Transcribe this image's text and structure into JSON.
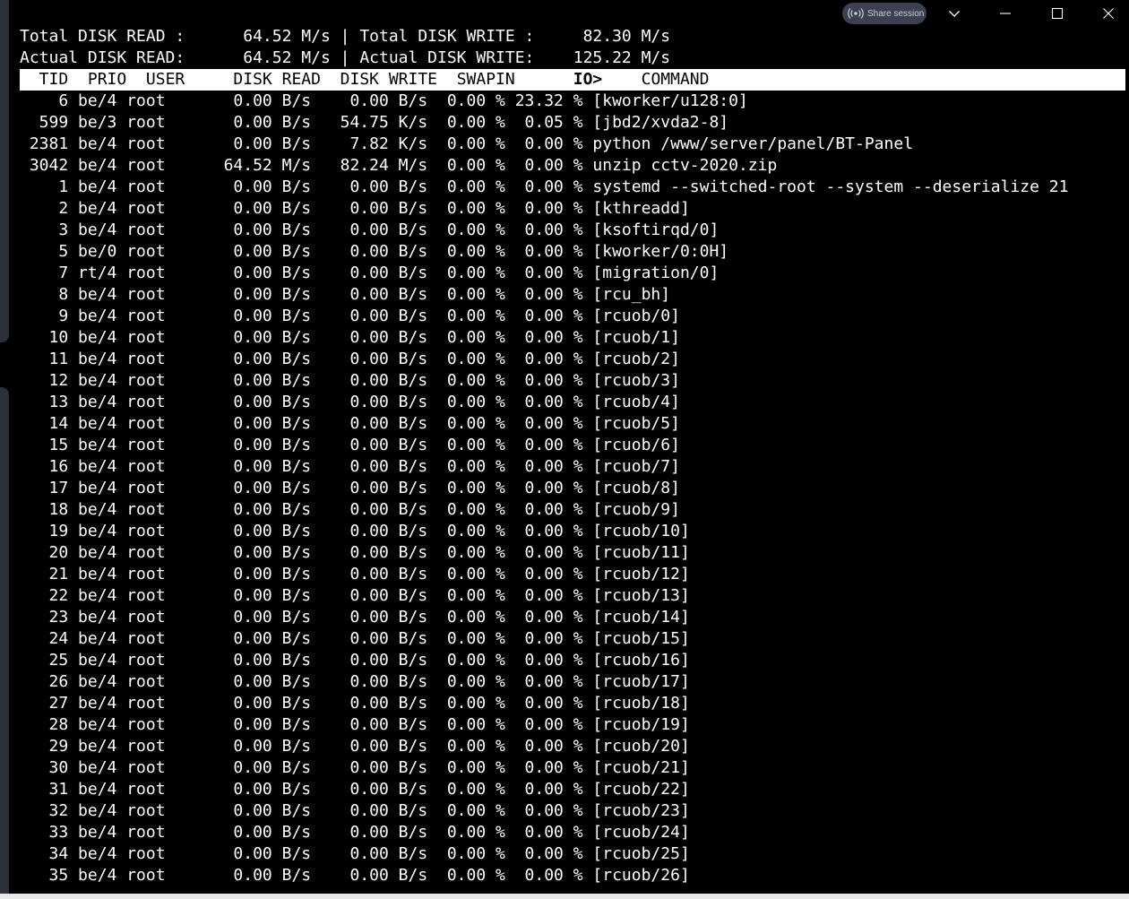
{
  "window": {
    "share_session_label": "Share session",
    "icons": {
      "share": "broadcast-icon",
      "chevron": "chevron-down-icon",
      "minimize": "minimize-icon",
      "maximize": "maximize-icon",
      "close": "close-icon"
    }
  },
  "summary": {
    "total_read_label": "Total DISK READ :",
    "total_read_value": "64.52 M/s",
    "total_write_label": "Total DISK WRITE :",
    "total_write_value": "82.30 M/s",
    "actual_read_label": "Actual DISK READ:",
    "actual_read_value": "64.52 M/s",
    "actual_write_label": "Actual DISK WRITE:",
    "actual_write_value": "125.22 M/s"
  },
  "columns": {
    "tid": "TID",
    "prio": "PRIO",
    "user": "USER",
    "disk_read": "DISK READ",
    "disk_write": "DISK WRITE",
    "swapin": "SWAPIN",
    "io": "IO>",
    "command": "COMMAND"
  },
  "processes": [
    {
      "tid": "6",
      "prio": "be/4",
      "user": "root",
      "read": "0.00 B/s",
      "write": "0.00 B/s",
      "swapin": "0.00 %",
      "io": "23.32 %",
      "command": "[kworker/u128:0]"
    },
    {
      "tid": "599",
      "prio": "be/3",
      "user": "root",
      "read": "0.00 B/s",
      "write": "54.75 K/s",
      "swapin": "0.00 %",
      "io": "0.05 %",
      "command": "[jbd2/xvda2-8]"
    },
    {
      "tid": "2381",
      "prio": "be/4",
      "user": "root",
      "read": "0.00 B/s",
      "write": "7.82 K/s",
      "swapin": "0.00 %",
      "io": "0.00 %",
      "command": "python /www/server/panel/BT-Panel"
    },
    {
      "tid": "3042",
      "prio": "be/4",
      "user": "root",
      "read": "64.52 M/s",
      "write": "82.24 M/s",
      "swapin": "0.00 %",
      "io": "0.00 %",
      "command": "unzip cctv-2020.zip"
    },
    {
      "tid": "1",
      "prio": "be/4",
      "user": "root",
      "read": "0.00 B/s",
      "write": "0.00 B/s",
      "swapin": "0.00 %",
      "io": "0.00 %",
      "command": "systemd --switched-root --system --deserialize 21"
    },
    {
      "tid": "2",
      "prio": "be/4",
      "user": "root",
      "read": "0.00 B/s",
      "write": "0.00 B/s",
      "swapin": "0.00 %",
      "io": "0.00 %",
      "command": "[kthreadd]"
    },
    {
      "tid": "3",
      "prio": "be/4",
      "user": "root",
      "read": "0.00 B/s",
      "write": "0.00 B/s",
      "swapin": "0.00 %",
      "io": "0.00 %",
      "command": "[ksoftirqd/0]"
    },
    {
      "tid": "5",
      "prio": "be/0",
      "user": "root",
      "read": "0.00 B/s",
      "write": "0.00 B/s",
      "swapin": "0.00 %",
      "io": "0.00 %",
      "command": "[kworker/0:0H]"
    },
    {
      "tid": "7",
      "prio": "rt/4",
      "user": "root",
      "read": "0.00 B/s",
      "write": "0.00 B/s",
      "swapin": "0.00 %",
      "io": "0.00 %",
      "command": "[migration/0]"
    },
    {
      "tid": "8",
      "prio": "be/4",
      "user": "root",
      "read": "0.00 B/s",
      "write": "0.00 B/s",
      "swapin": "0.00 %",
      "io": "0.00 %",
      "command": "[rcu_bh]"
    },
    {
      "tid": "9",
      "prio": "be/4",
      "user": "root",
      "read": "0.00 B/s",
      "write": "0.00 B/s",
      "swapin": "0.00 %",
      "io": "0.00 %",
      "command": "[rcuob/0]"
    },
    {
      "tid": "10",
      "prio": "be/4",
      "user": "root",
      "read": "0.00 B/s",
      "write": "0.00 B/s",
      "swapin": "0.00 %",
      "io": "0.00 %",
      "command": "[rcuob/1]"
    },
    {
      "tid": "11",
      "prio": "be/4",
      "user": "root",
      "read": "0.00 B/s",
      "write": "0.00 B/s",
      "swapin": "0.00 %",
      "io": "0.00 %",
      "command": "[rcuob/2]"
    },
    {
      "tid": "12",
      "prio": "be/4",
      "user": "root",
      "read": "0.00 B/s",
      "write": "0.00 B/s",
      "swapin": "0.00 %",
      "io": "0.00 %",
      "command": "[rcuob/3]"
    },
    {
      "tid": "13",
      "prio": "be/4",
      "user": "root",
      "read": "0.00 B/s",
      "write": "0.00 B/s",
      "swapin": "0.00 %",
      "io": "0.00 %",
      "command": "[rcuob/4]"
    },
    {
      "tid": "14",
      "prio": "be/4",
      "user": "root",
      "read": "0.00 B/s",
      "write": "0.00 B/s",
      "swapin": "0.00 %",
      "io": "0.00 %",
      "command": "[rcuob/5]"
    },
    {
      "tid": "15",
      "prio": "be/4",
      "user": "root",
      "read": "0.00 B/s",
      "write": "0.00 B/s",
      "swapin": "0.00 %",
      "io": "0.00 %",
      "command": "[rcuob/6]"
    },
    {
      "tid": "16",
      "prio": "be/4",
      "user": "root",
      "read": "0.00 B/s",
      "write": "0.00 B/s",
      "swapin": "0.00 %",
      "io": "0.00 %",
      "command": "[rcuob/7]"
    },
    {
      "tid": "17",
      "prio": "be/4",
      "user": "root",
      "read": "0.00 B/s",
      "write": "0.00 B/s",
      "swapin": "0.00 %",
      "io": "0.00 %",
      "command": "[rcuob/8]"
    },
    {
      "tid": "18",
      "prio": "be/4",
      "user": "root",
      "read": "0.00 B/s",
      "write": "0.00 B/s",
      "swapin": "0.00 %",
      "io": "0.00 %",
      "command": "[rcuob/9]"
    },
    {
      "tid": "19",
      "prio": "be/4",
      "user": "root",
      "read": "0.00 B/s",
      "write": "0.00 B/s",
      "swapin": "0.00 %",
      "io": "0.00 %",
      "command": "[rcuob/10]"
    },
    {
      "tid": "20",
      "prio": "be/4",
      "user": "root",
      "read": "0.00 B/s",
      "write": "0.00 B/s",
      "swapin": "0.00 %",
      "io": "0.00 %",
      "command": "[rcuob/11]"
    },
    {
      "tid": "21",
      "prio": "be/4",
      "user": "root",
      "read": "0.00 B/s",
      "write": "0.00 B/s",
      "swapin": "0.00 %",
      "io": "0.00 %",
      "command": "[rcuob/12]"
    },
    {
      "tid": "22",
      "prio": "be/4",
      "user": "root",
      "read": "0.00 B/s",
      "write": "0.00 B/s",
      "swapin": "0.00 %",
      "io": "0.00 %",
      "command": "[rcuob/13]"
    },
    {
      "tid": "23",
      "prio": "be/4",
      "user": "root",
      "read": "0.00 B/s",
      "write": "0.00 B/s",
      "swapin": "0.00 %",
      "io": "0.00 %",
      "command": "[rcuob/14]"
    },
    {
      "tid": "24",
      "prio": "be/4",
      "user": "root",
      "read": "0.00 B/s",
      "write": "0.00 B/s",
      "swapin": "0.00 %",
      "io": "0.00 %",
      "command": "[rcuob/15]"
    },
    {
      "tid": "25",
      "prio": "be/4",
      "user": "root",
      "read": "0.00 B/s",
      "write": "0.00 B/s",
      "swapin": "0.00 %",
      "io": "0.00 %",
      "command": "[rcuob/16]"
    },
    {
      "tid": "26",
      "prio": "be/4",
      "user": "root",
      "read": "0.00 B/s",
      "write": "0.00 B/s",
      "swapin": "0.00 %",
      "io": "0.00 %",
      "command": "[rcuob/17]"
    },
    {
      "tid": "27",
      "prio": "be/4",
      "user": "root",
      "read": "0.00 B/s",
      "write": "0.00 B/s",
      "swapin": "0.00 %",
      "io": "0.00 %",
      "command": "[rcuob/18]"
    },
    {
      "tid": "28",
      "prio": "be/4",
      "user": "root",
      "read": "0.00 B/s",
      "write": "0.00 B/s",
      "swapin": "0.00 %",
      "io": "0.00 %",
      "command": "[rcuob/19]"
    },
    {
      "tid": "29",
      "prio": "be/4",
      "user": "root",
      "read": "0.00 B/s",
      "write": "0.00 B/s",
      "swapin": "0.00 %",
      "io": "0.00 %",
      "command": "[rcuob/20]"
    },
    {
      "tid": "30",
      "prio": "be/4",
      "user": "root",
      "read": "0.00 B/s",
      "write": "0.00 B/s",
      "swapin": "0.00 %",
      "io": "0.00 %",
      "command": "[rcuob/21]"
    },
    {
      "tid": "31",
      "prio": "be/4",
      "user": "root",
      "read": "0.00 B/s",
      "write": "0.00 B/s",
      "swapin": "0.00 %",
      "io": "0.00 %",
      "command": "[rcuob/22]"
    },
    {
      "tid": "32",
      "prio": "be/4",
      "user": "root",
      "read": "0.00 B/s",
      "write": "0.00 B/s",
      "swapin": "0.00 %",
      "io": "0.00 %",
      "command": "[rcuob/23]"
    },
    {
      "tid": "33",
      "prio": "be/4",
      "user": "root",
      "read": "0.00 B/s",
      "write": "0.00 B/s",
      "swapin": "0.00 %",
      "io": "0.00 %",
      "command": "[rcuob/24]"
    },
    {
      "tid": "34",
      "prio": "be/4",
      "user": "root",
      "read": "0.00 B/s",
      "write": "0.00 B/s",
      "swapin": "0.00 %",
      "io": "0.00 %",
      "command": "[rcuob/25]"
    },
    {
      "tid": "35",
      "prio": "be/4",
      "user": "root",
      "read": "0.00 B/s",
      "write": "0.00 B/s",
      "swapin": "0.00 %",
      "io": "0.00 %",
      "command": "[rcuob/26]"
    }
  ]
}
